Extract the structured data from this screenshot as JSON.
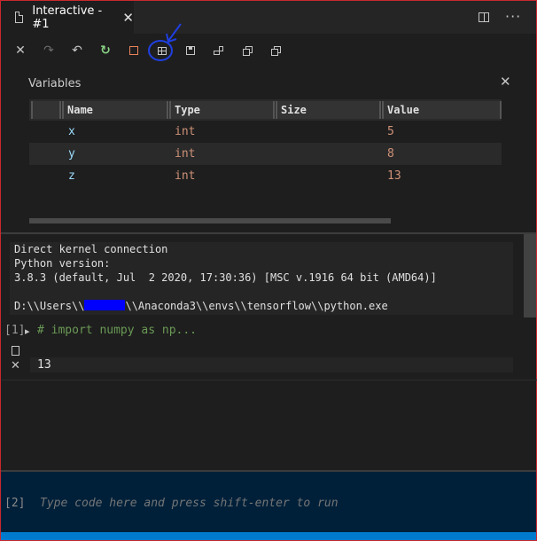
{
  "tab": {
    "title": "Interactive - #1",
    "close_glyph": "✕"
  },
  "title_actions": {
    "split_icon": "split-editor-icon",
    "more_glyph": "···"
  },
  "toolbar": {
    "icons": [
      "close-icon",
      "redo-icon",
      "undo-icon",
      "restart-kernel-icon",
      "interrupt-kernel-icon",
      "variables-grid-icon",
      "save-icon",
      "export-icon",
      "expand-all-icon",
      "collapse-all-icon"
    ],
    "close_glyph": "✕",
    "redo_glyph": "↷",
    "undo_glyph": "↶",
    "restart_glyph": "↻",
    "annotation_color": "#1f3fe0"
  },
  "variables": {
    "title": "Variables",
    "close_glyph": "✕",
    "columns": [
      "Name",
      "Type",
      "Size",
      "Value"
    ],
    "rows": [
      {
        "name": "x",
        "type": "int",
        "size": "",
        "value": "5"
      },
      {
        "name": "y",
        "type": "int",
        "size": "",
        "value": "8"
      },
      {
        "name": "z",
        "type": "int",
        "size": "",
        "value": "13"
      }
    ]
  },
  "kernel_info": {
    "line1": "Direct kernel connection",
    "line2": "Python version:",
    "line3": "3.8.3 (default, Jul  2 2020, 17:30:36) [MSC v.1916 64 bit (AMD64)]",
    "path_prefix": "D:\\\\Users\\\\",
    "path_suffix": "\\\\Anaconda3\\\\envs\\\\tensorflow\\\\python.exe",
    "redaction_color": "#0000ff"
  },
  "cell1": {
    "label": "[1]",
    "chevron": "▸",
    "code": "# import numpy as np...",
    "output": "13",
    "delete_glyph": "✕"
  },
  "input": {
    "label": "[2]",
    "placeholder": "Type code here and press shift-enter to run"
  },
  "colors": {
    "frame": "#c8282d",
    "statusbar": "#007acc",
    "input_bg": "#00203a"
  }
}
